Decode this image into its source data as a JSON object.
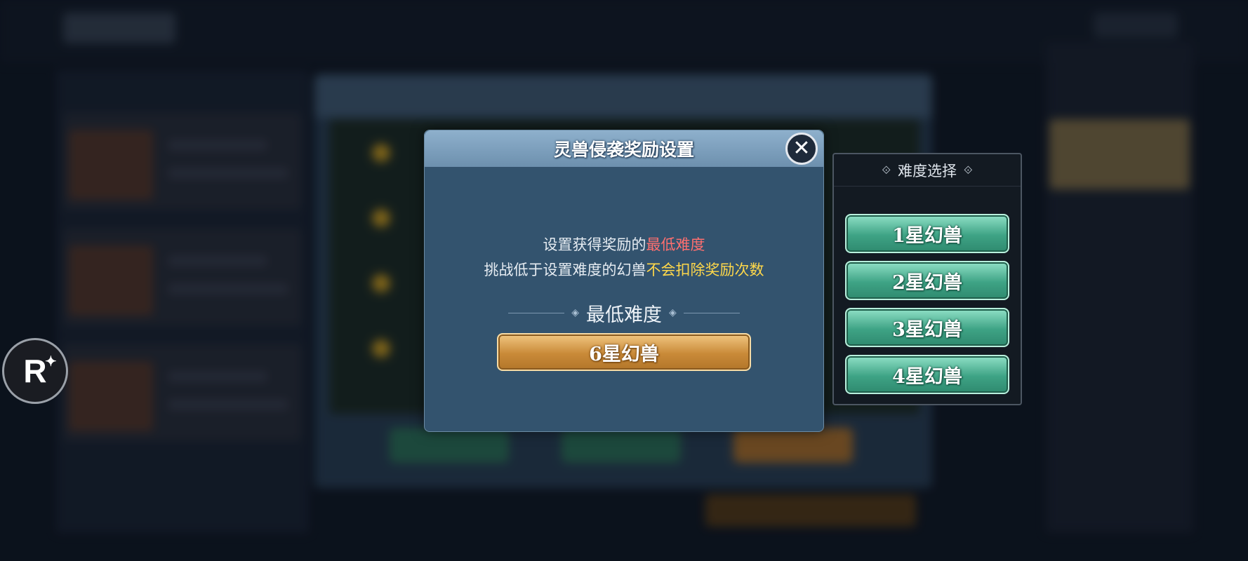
{
  "dialog": {
    "title": "灵兽侵袭奖励设置",
    "close_icon": "close-icon",
    "desc_line1_prefix": "设置获得奖励的",
    "desc_line1_highlight": "最低难度",
    "desc_line2_prefix": "挑战低于设置难度的幻兽",
    "desc_line2_highlight": "不会扣除奖励次数",
    "min_label": "最低难度",
    "selected_difficulty": "6星幻兽"
  },
  "difficulty_panel": {
    "title": "难度选择",
    "options": [
      {
        "label": "1星幻兽"
      },
      {
        "label": "2星幻兽"
      },
      {
        "label": "3星幻兽"
      },
      {
        "label": "4星幻兽"
      }
    ]
  },
  "floating_button": {
    "label": "R",
    "icon": "sparkle-icon"
  },
  "colors": {
    "highlight_red": "#ff6f6f",
    "highlight_yellow": "#ffd84a",
    "dialog_bg": "#33536e",
    "button_gold": "#c98a38",
    "button_teal": "#3ea385"
  }
}
